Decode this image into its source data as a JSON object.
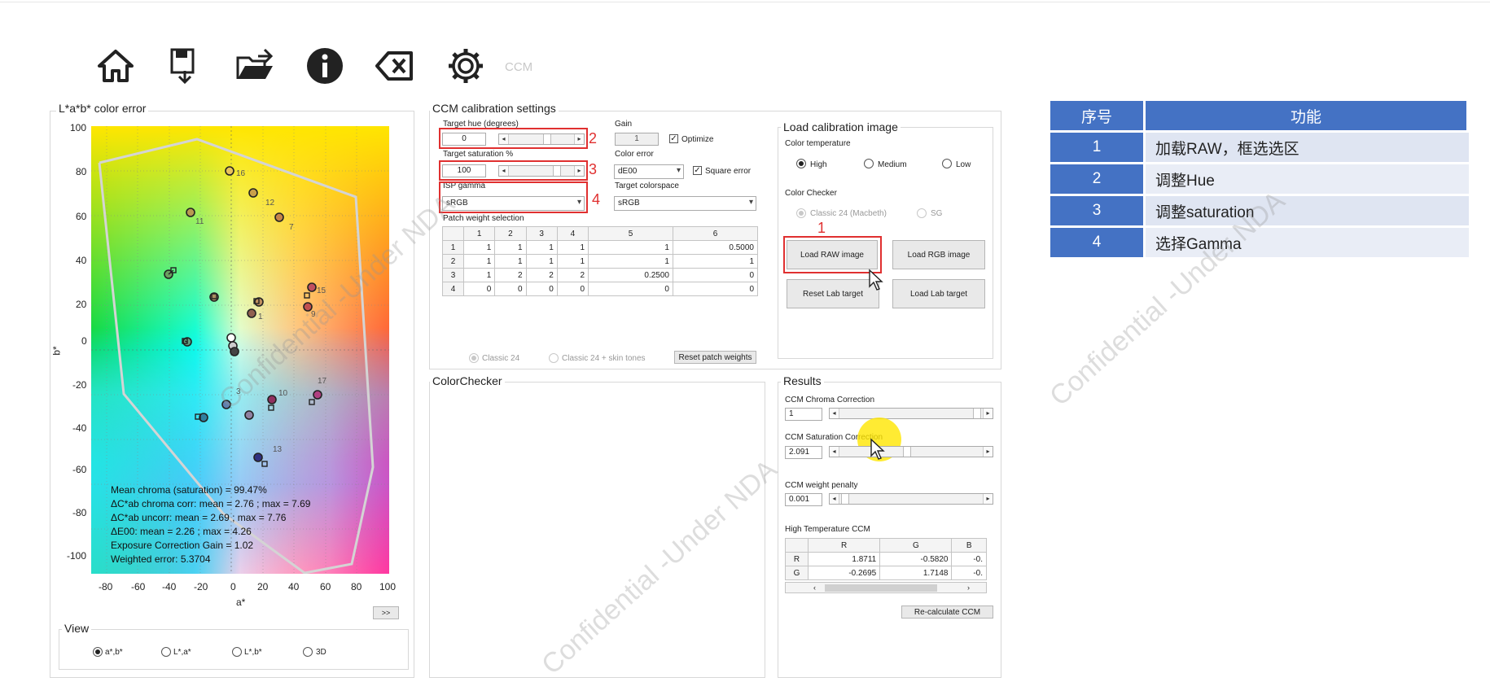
{
  "toolbar": {
    "icons": [
      "home-icon",
      "save-icon",
      "open-folder-icon",
      "info-icon",
      "clear-icon",
      "gear-icon"
    ],
    "ccm_label": "CCM"
  },
  "color_error": {
    "legend": "L*a*b* color error",
    "y_axis_label": "b*",
    "x_axis_label": "a*",
    "y_ticks": [
      "100",
      "80",
      "60",
      "40",
      "20",
      "0",
      "-20",
      "-40",
      "-60",
      "-80",
      "-100"
    ],
    "x_ticks": [
      "-80",
      "-60",
      "-40",
      "-20",
      "0",
      "20",
      "40",
      "60",
      "80",
      "100"
    ],
    "stats": [
      "Mean chroma (saturation) = 99.47%",
      "ΔC*ab chroma corr: mean = 2.76 ; max = 7.69",
      "ΔC*ab uncorr: mean = 2.69 ; max = 7.76",
      "ΔE00: mean = 2.26 ; max = 4.26",
      "Exposure Correction Gain = 1.02",
      "Weighted error: 5.3704"
    ],
    "expand_button": ">>",
    "patch_labels": [
      {
        "n": "16",
        "a": 0,
        "b": 80
      },
      {
        "n": "12",
        "a": 14,
        "b": 68
      },
      {
        "n": "7",
        "a": 30,
        "b": 57
      },
      {
        "n": "11",
        "a": -26,
        "b": 59
      },
      {
        "n": "15",
        "a": 52,
        "b": 24
      },
      {
        "n": "9",
        "a": 50,
        "b": 16
      },
      {
        "n": "1",
        "a": 14,
        "b": 14
      },
      {
        "n": "17",
        "a": 54,
        "b": -13
      },
      {
        "n": "10",
        "a": 26,
        "b": -20
      },
      {
        "n": "3",
        "a": 0,
        "b": -22
      },
      {
        "n": "13",
        "a": 22,
        "b": -48
      }
    ]
  },
  "view": {
    "legend": "View",
    "options": [
      "a*,b*",
      "L*,a*",
      "L*,b*",
      "3D"
    ],
    "selected": "a*,b*"
  },
  "ccm_settings": {
    "legend": "CCM calibration settings",
    "target_hue_label": "Target hue (degrees)",
    "target_hue_value": "0",
    "gain_label": "Gain",
    "gain_value": "1",
    "optimize_label": "Optimize",
    "target_saturation_label": "Target saturation %",
    "target_saturation_value": "100",
    "color_error_label": "Color error",
    "color_error_value": "dE00",
    "square_error_label": "Square error",
    "isp_gamma_label": "ISP gamma",
    "isp_gamma_value": "sRGB",
    "target_colorspace_label": "Target colorspace",
    "target_colorspace_value": "sRGB",
    "patch_weight_label": "Patch weight selection",
    "patch_columns": [
      "1",
      "2",
      "3",
      "4",
      "5",
      "6"
    ],
    "patch_rows": [
      {
        "h": "1",
        "v": [
          "1",
          "1",
          "1",
          "1",
          "1",
          "0.5000"
        ]
      },
      {
        "h": "2",
        "v": [
          "1",
          "1",
          "1",
          "1",
          "1",
          "1"
        ]
      },
      {
        "h": "3",
        "v": [
          "1",
          "2",
          "2",
          "2",
          "0.2500",
          "0"
        ]
      },
      {
        "h": "4",
        "v": [
          "0",
          "0",
          "0",
          "0",
          "0",
          "0"
        ]
      }
    ],
    "classic24_label": "Classic 24",
    "classic24_skin_label": "Classic 24 + skin tones",
    "reset_weights_label": "Reset patch weights"
  },
  "annotations": [
    "1",
    "2",
    "3",
    "4"
  ],
  "load_image": {
    "legend": "Load calibration image",
    "color_temp_label": "Color temperature",
    "temps": [
      "High",
      "Medium",
      "Low"
    ],
    "color_checker_label": "Color Checker",
    "checkers": [
      "Classic 24 (Macbeth)",
      "SG"
    ],
    "load_raw": "Load RAW image",
    "load_rgb": "Load RGB image",
    "reset_lab": "Reset Lab target",
    "load_lab": "Load Lab target"
  },
  "colorchecker": {
    "legend": "ColorChecker"
  },
  "results": {
    "legend": "Results",
    "chroma_label": "CCM Chroma Correction",
    "chroma_value": "1",
    "saturation_label": "CCM Saturation Correction",
    "saturation_value": "2.091",
    "penalty_label": "CCM weight penalty",
    "penalty_value": "0.001",
    "ccm_table_label": "High Temperature CCM",
    "ccm_cols": [
      "R",
      "G",
      "B"
    ],
    "ccm_rows": [
      {
        "h": "R",
        "v": [
          "1.8711",
          "-0.5820",
          "-0."
        ]
      },
      {
        "h": "G",
        "v": [
          "-0.2695",
          "1.7148",
          "-0."
        ]
      }
    ],
    "recalc": "Re-calculate CCM"
  },
  "info_table": {
    "headers": [
      "序号",
      "功能"
    ],
    "rows": [
      {
        "no": "1",
        "fn": "加载RAW，框选选区"
      },
      {
        "no": "2",
        "fn": "调整Hue"
      },
      {
        "no": "3",
        "fn": "调整saturation"
      },
      {
        "no": "4",
        "fn": "选择Gamma"
      }
    ]
  },
  "watermark": "Confidential -Under NDA"
}
